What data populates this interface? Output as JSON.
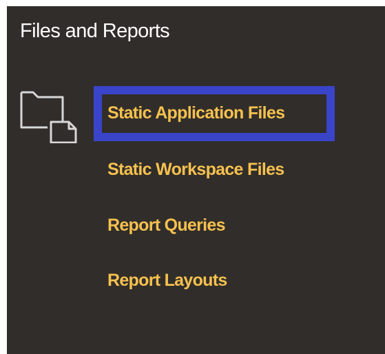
{
  "section": {
    "title": "Files and Reports",
    "icon": "folder-document-icon",
    "links": [
      {
        "label": "Static Application Files",
        "selected": true
      },
      {
        "label": "Static Workspace Files",
        "selected": false
      },
      {
        "label": "Report Queries",
        "selected": false
      },
      {
        "label": "Report Layouts",
        "selected": false
      }
    ]
  },
  "colors": {
    "panel_background": "#312d2a",
    "title_text": "#ffffff",
    "link_text": "#f6c14f",
    "selection_border": "#3a44c8",
    "icon_stroke": "#d8d8d8"
  }
}
